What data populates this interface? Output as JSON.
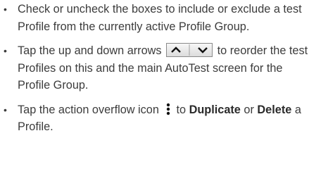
{
  "list": {
    "item1": {
      "text": "Check or uncheck the boxes to include or exclude a test Profile from the currently active Profile Group."
    },
    "item2": {
      "before": "Tap the up and down arrows",
      "after": "to reorder the test Profiles on this and the main AutoTest screen for the Profile Group."
    },
    "item3": {
      "before": "Tap the action overflow icon",
      "middle": "to",
      "duplicate": "Duplicate",
      "or": "or",
      "delete": "Delete",
      "end": "a Profile."
    }
  },
  "icons": {
    "reorder": [
      "chevron-up-icon",
      "chevron-down-icon"
    ],
    "overflow": "vertical-ellipsis-icon"
  }
}
